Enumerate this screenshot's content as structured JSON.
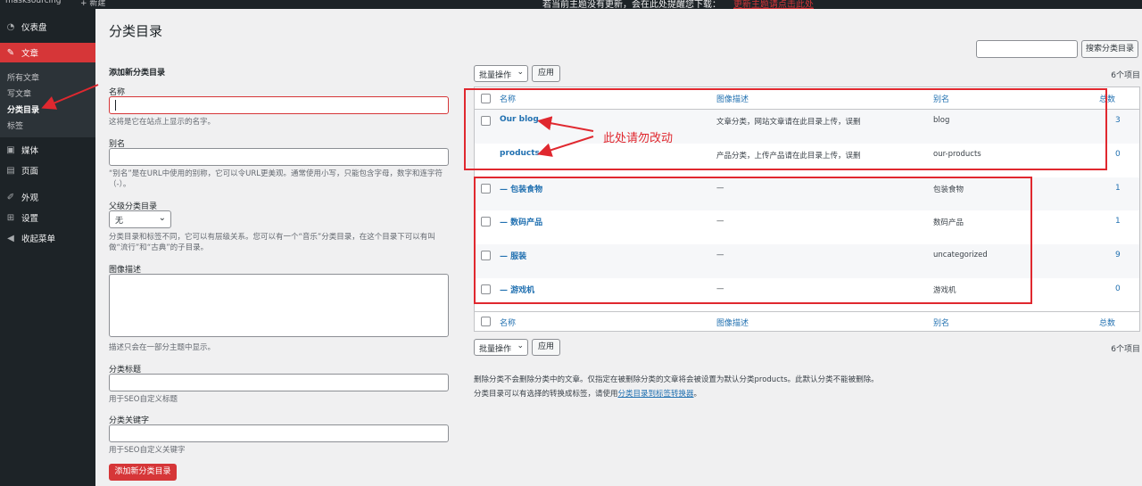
{
  "adminbar": {
    "site_name": "masksourcing",
    "new_label": "+ 新建",
    "notice": "若当前主题没有更新，会在此处提醒您下载：",
    "notice_link": "更新主题请点击此处"
  },
  "sidebar": {
    "items": [
      {
        "label": "仪表盘",
        "icon": "gauge-icon"
      },
      {
        "label": "文章",
        "icon": "pin-icon",
        "active": true
      },
      {
        "label": "媒体",
        "icon": "media-icon"
      },
      {
        "label": "页面",
        "icon": "page-icon"
      },
      {
        "label": "外观",
        "icon": "brush-icon"
      },
      {
        "label": "设置",
        "icon": "settings-icon"
      },
      {
        "label": "收起菜单",
        "icon": "collapse-icon"
      }
    ],
    "submenu": [
      "所有文章",
      "写文章",
      "分类目录",
      "标签"
    ]
  },
  "page": {
    "title": "分类目录"
  },
  "form": {
    "heading": "添加新分类目录",
    "name_label": "名称",
    "name_help": "这将是它在站点上显示的名字。",
    "slug_label": "别名",
    "slug_help": "“别名”是在URL中使用的别称，它可以令URL更美观。通常使用小写，只能包含字母，数字和连字符（-）。",
    "parent_label": "父级分类目录",
    "parent_value": "无",
    "parent_help": "分类目录和标签不同，它可以有层级关系。您可以有一个“音乐”分类目录，在这个目录下可以有叫做“流行”和“古典”的子目录。",
    "desc_label": "图像描述",
    "desc_help": "描述只会在一部分主题中显示。",
    "seo_title_label": "分类标题",
    "seo_title_help": "用于SEO自定义标题",
    "seo_kw_label": "分类关键字",
    "seo_kw_help": "用于SEO自定义关键字",
    "submit": "添加新分类目录"
  },
  "toolbar": {
    "search_button": "搜索分类目录",
    "bulk_label": "批量操作",
    "apply": "应用",
    "count": "6个项目"
  },
  "table": {
    "headers": [
      "名称",
      "图像描述",
      "别名",
      "总数"
    ],
    "rows": [
      {
        "name": "Our blog",
        "desc": "文章分类，网站文章请在此目录上传，误删",
        "slug": "blog",
        "count": "3",
        "checkbox": true
      },
      {
        "name": "products",
        "desc": "产品分类，上传产品请在此目录上传，误删",
        "slug": "our-products",
        "count": "0",
        "checkbox": false
      },
      {
        "name": "— 包装食物",
        "desc": "—",
        "slug": "包装食物",
        "count": "1",
        "checkbox": true
      },
      {
        "name": "— 数码产品",
        "desc": "—",
        "slug": "数码产品",
        "count": "1",
        "checkbox": true
      },
      {
        "name": "— 服装",
        "desc": "—",
        "slug": "uncategorized",
        "count": "9",
        "checkbox": true
      },
      {
        "name": "— 游戏机",
        "desc": "—",
        "slug": "游戏机",
        "count": "0",
        "checkbox": true
      }
    ]
  },
  "notes": {
    "line1": "删除分类不会删除分类中的文章。仅指定在被删除分类的文章将会被设置为默认分类products。此默认分类不能被删除。",
    "line2_prefix": "分类目录可以有选择的转换成标签，请使用",
    "line2_link": "分类目录到标签转换器",
    "line2_suffix": "。"
  },
  "annotation": {
    "text": "此处请勿改动",
    "color": "#e0282f"
  }
}
